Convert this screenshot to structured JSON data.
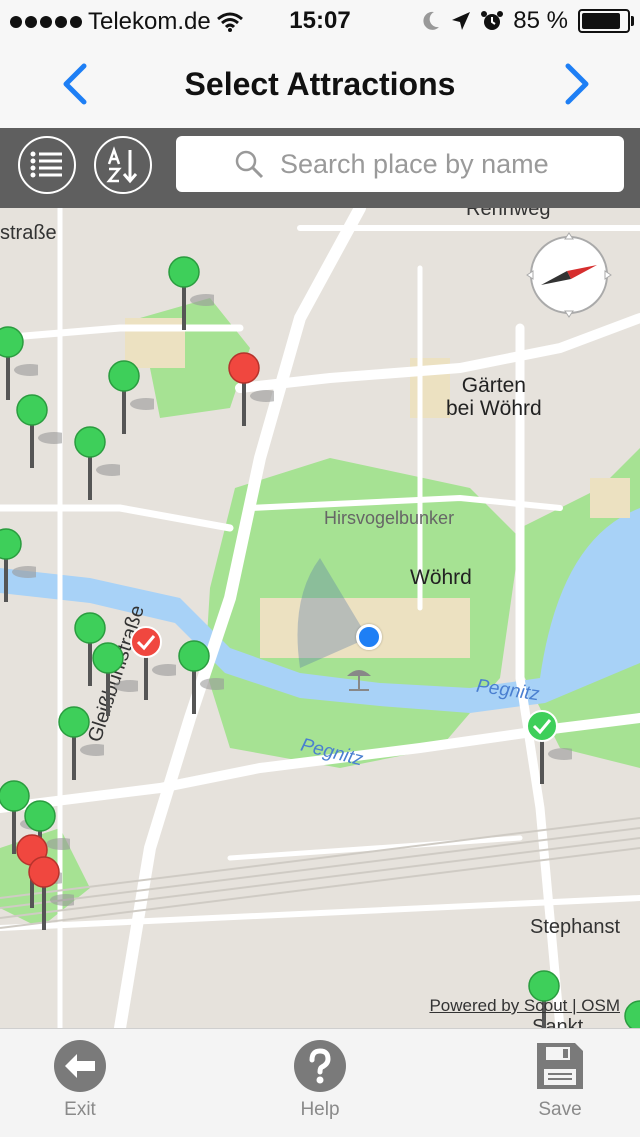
{
  "status": {
    "carrier": "Telekom.de",
    "time": "15:07",
    "battery": "85 %"
  },
  "nav": {
    "title": "Select Attractions"
  },
  "search": {
    "placeholder": "Search place by name"
  },
  "map": {
    "labels": {
      "street_tl": "straße",
      "street_top": "Rennweg",
      "gaerten": "Gärten\nbei Wöhrd",
      "bunker": "Hirsvogelbunker",
      "woehrd": "Wöhrd",
      "pegnitz1": "Pegnitz",
      "pegnitz2": "Pegnitz",
      "gleiss": "Gleißbühlstraße",
      "stephan": "Stephanst",
      "sankt": "Sankt"
    },
    "attribution": "Powered by Scout | OSM",
    "pins": [
      {
        "status": "unselected",
        "color": "#3ecf5a"
      },
      {
        "status": "excluded",
        "color": "#f0473f"
      },
      {
        "status": "selected",
        "color": "#3ecf5a"
      },
      {
        "status": "selected",
        "color": "#f0473f"
      }
    ]
  },
  "tabs": {
    "exit": "Exit",
    "help": "Help",
    "save": "Save"
  },
  "icons": [
    "wifi-icon",
    "moon-icon",
    "location-arrow-icon",
    "alarm-icon",
    "chevron-left-icon",
    "chevron-right-icon",
    "list-icon",
    "sort-az-icon",
    "search-icon",
    "compass-icon",
    "exit-arrow-icon",
    "help-icon",
    "save-disk-icon"
  ],
  "colors": {
    "accent": "#1e7ff5",
    "toolbar": "#5f5f5f",
    "pin_green": "#3ecf5a",
    "pin_red": "#f0473f",
    "park": "#9ee08a",
    "water": "#a8d2f7"
  }
}
